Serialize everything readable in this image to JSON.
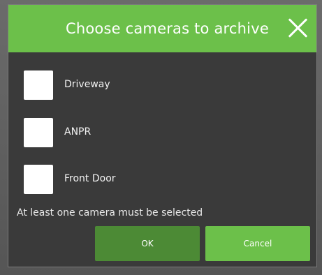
{
  "dialog": {
    "title": "Choose cameras to archive",
    "close_icon": "close-icon",
    "cameras": [
      {
        "label": "Driveway",
        "checked": false
      },
      {
        "label": "ANPR",
        "checked": false
      },
      {
        "label": "Front Door",
        "checked": false
      }
    ],
    "validation_message": "At least one camera must be selected",
    "ok_label": "OK",
    "cancel_label": "Cancel"
  },
  "colors": {
    "accent": "#6cc04a",
    "ok_button": "#4c8a35",
    "dialog_background": "#3a3a3a"
  }
}
